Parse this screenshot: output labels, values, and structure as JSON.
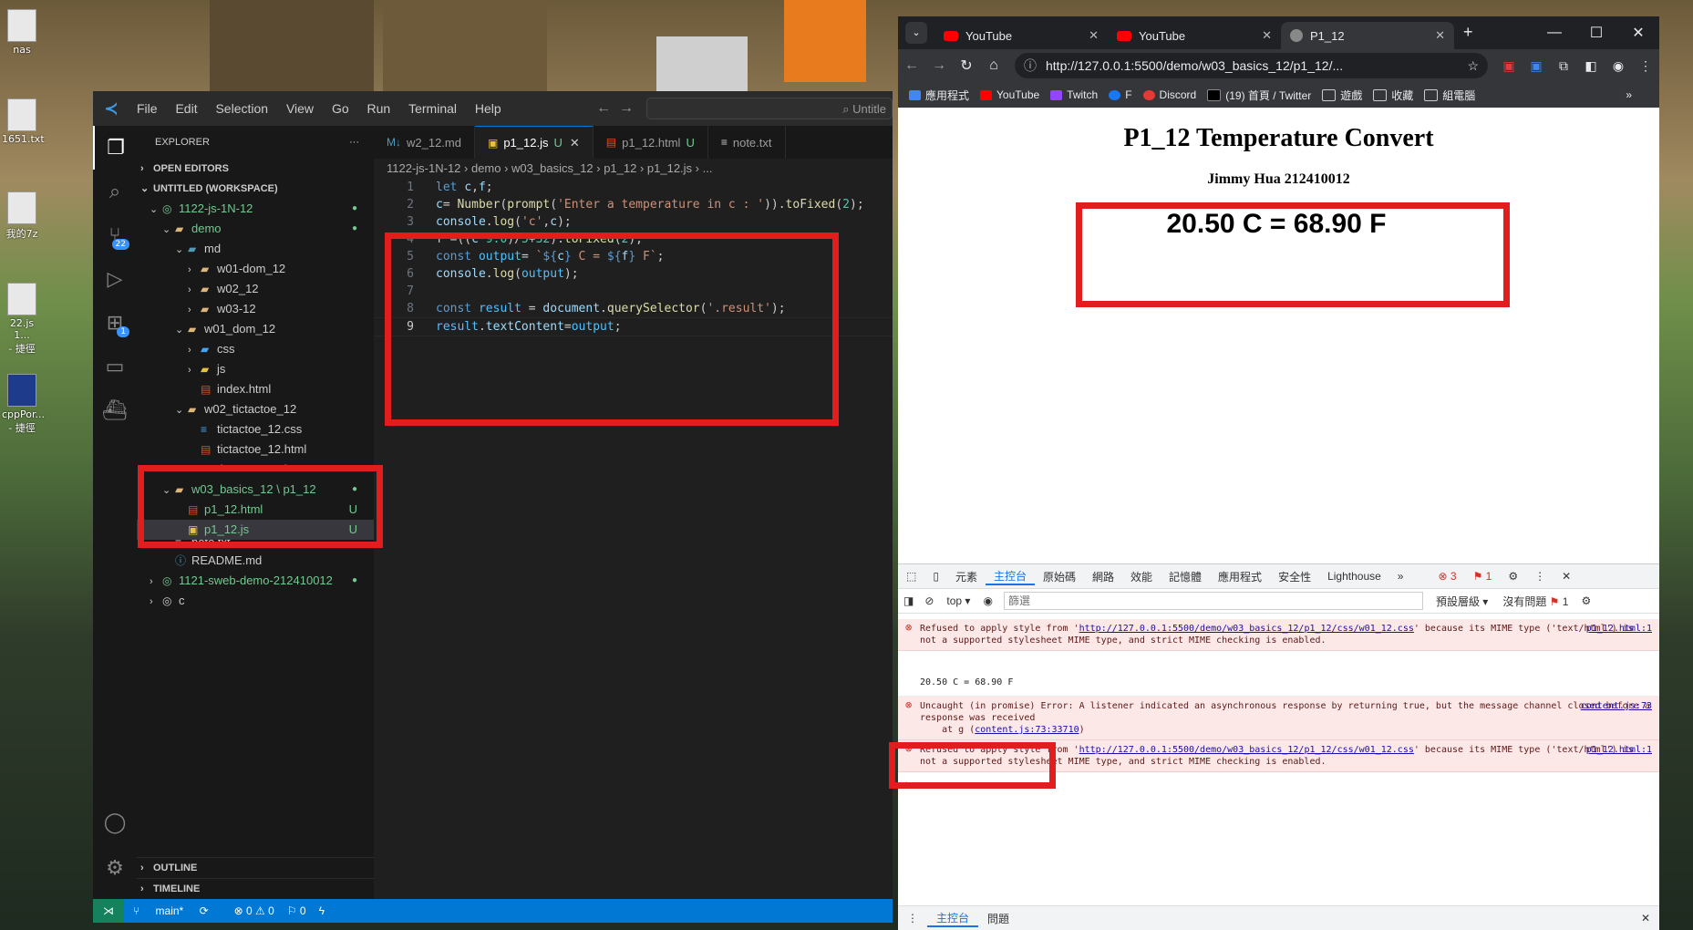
{
  "desktop": {
    "icons": [
      {
        "label": "nas"
      },
      {
        "label": "1651.txt"
      },
      {
        "label": "我的7z"
      },
      {
        "label": "22.js 1...\n- 捷徑"
      },
      {
        "label": "cppPor...\n- 捷徑"
      }
    ]
  },
  "vscode": {
    "menu": [
      "File",
      "Edit",
      "Selection",
      "View",
      "Go",
      "Run",
      "Terminal",
      "Help"
    ],
    "command_center": "Untitle",
    "explorer_title": "EXPLORER",
    "explorer_more": "···",
    "open_editors": "OPEN EDITORS",
    "workspace": "UNTITLED (WORKSPACE)",
    "tree": [
      {
        "label": "1122-js-1N-12"
      },
      {
        "label": "demo"
      },
      {
        "label": "md"
      },
      {
        "label": "w01-dom_12"
      },
      {
        "label": "w02_12"
      },
      {
        "label": "w03-12"
      },
      {
        "label": "w01_dom_12"
      },
      {
        "label": "css"
      },
      {
        "label": "js"
      },
      {
        "label": "index.html"
      },
      {
        "label": "w02_tictactoe_12"
      },
      {
        "label": "tictactoe_12.css"
      },
      {
        "label": "tictactoe_12.html"
      },
      {
        "label": "tictactoe_12.js"
      },
      {
        "label": "w03_basics_12 \\ p1_12"
      },
      {
        "label": "p1_12.html",
        "status": "U"
      },
      {
        "label": "p1_12.js",
        "status": "U"
      },
      {
        "label": "note.txt"
      },
      {
        "label": "README.md"
      },
      {
        "label": "1121-sweb-demo-212410012"
      },
      {
        "label": "c"
      }
    ],
    "outline": "OUTLINE",
    "timeline": "TIMELINE",
    "scm_badge": "22",
    "ext_badge": "1",
    "tabs": [
      {
        "label": "w2_12.md"
      },
      {
        "label": "p1_12.js",
        "status": "U"
      },
      {
        "label": "p1_12.html",
        "status": "U"
      },
      {
        "label": "note.txt"
      }
    ],
    "breadcrumb": "1122-js-1N-12 › demo › w03_basics_12 › p1_12 › p1_12.js › ...",
    "code": [
      {
        "n": "1",
        "text": "let c,f;"
      },
      {
        "n": "2",
        "text": "c= Number(prompt('Enter a temperature in c : ')).toFixed(2);"
      },
      {
        "n": "3",
        "text": "console.log('c',c);"
      },
      {
        "n": "4",
        "text": "f =((c*9.0)/5+32).toFixed(2);"
      },
      {
        "n": "5",
        "text": "const output= `${c} C = ${f} F`;"
      },
      {
        "n": "6",
        "text": "console.log(output);"
      },
      {
        "n": "7",
        "text": ""
      },
      {
        "n": "8",
        "text": "const result = document.querySelector('.result');"
      },
      {
        "n": "9",
        "text": "result.textContent=output;"
      }
    ],
    "status": {
      "branch": "main*",
      "problems": "⊗ 0 ⚠ 0",
      "ports": "⚐ 0"
    }
  },
  "chrome": {
    "tabs": [
      {
        "title": "YouTube"
      },
      {
        "title": "YouTube"
      },
      {
        "title": "P1_12"
      }
    ],
    "url": "http://127.0.0.1:5500/demo/w03_basics_12/p1_12/...",
    "bookmarks": [
      "應用程式",
      "YouTube",
      "Twitch",
      "F",
      "Discord",
      "(19) 首頁 / Twitter",
      "遊戲",
      "收藏",
      "組電腦"
    ],
    "page": {
      "title": "P1_12 Temperature Convert",
      "subtitle": "Jimmy Hua 212410012",
      "result": "20.50 C = 68.90 F"
    },
    "devtools": {
      "tabs": [
        "元素",
        "主控台",
        "原始碼",
        "網路",
        "效能",
        "記憶體",
        "應用程式",
        "安全性",
        "Lighthouse"
      ],
      "errors": "3",
      "warnings": "1",
      "context": "top",
      "filter_placeholder": "篩選",
      "levels": "預設層級",
      "issues": "沒有問題",
      "issues_count": "1",
      "messages": [
        {
          "type": "err",
          "pre": "Refused to apply style from '",
          "link": "http://127.0.0.1:5500/demo/w03_basics_12/p1_12/css/w01_12.css",
          "post": "' because its MIME type ('text/html') is not a supported stylesheet MIME type, and strict MIME checking is enabled.",
          "src": "p1_12.html:1"
        },
        {
          "type": "log",
          "text": "20.50 C = 68.90 F"
        },
        {
          "type": "err",
          "pre": "Uncaught (in promise) Error: A listener indicated an asynchronous response by returning true, but the message channel closed before a response was received\n    at g (",
          "link": "content.js:73:33710",
          "post": ")",
          "src": "content.js:73"
        },
        {
          "type": "err",
          "pre": "Refused to apply style from '",
          "link": "http://127.0.0.1:5500/demo/w03_basics_12/p1_12/css/w01_12.css",
          "post": "' because its MIME type ('text/html') is not a supported stylesheet MIME type, and strict MIME checking is enabled.",
          "src": "p1_12.html:1"
        }
      ],
      "drawer_tabs": [
        "主控台",
        "問題"
      ]
    }
  }
}
